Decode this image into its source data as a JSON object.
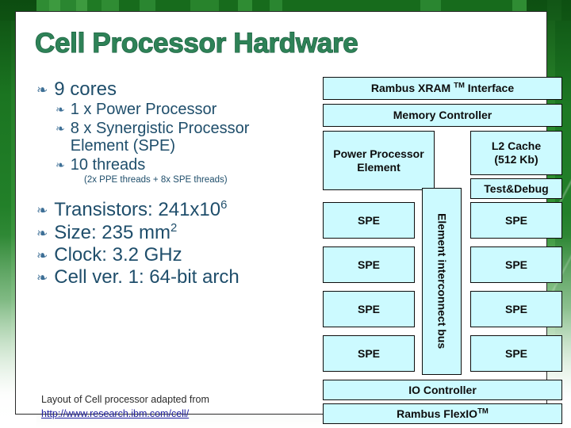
{
  "slide": {
    "title": "Cell Processor Hardware",
    "accent_green": "#2e8257",
    "text_blue": "#1f4e6b",
    "box_fill": "#ccfaff",
    "bullet_glyph": "❧"
  },
  "bullets": {
    "cores_heading": "9 cores",
    "sub": [
      {
        "text": "1 x Power Processor"
      },
      {
        "text": "8 x Synergistic Processor Element (SPE)"
      },
      {
        "text": "10 threads"
      }
    ],
    "threads_note": "(2x PPE threads + 8x SPE threads)",
    "facts": [
      {
        "label": "Transistors: 241x10",
        "sup": "6"
      },
      {
        "label": "Size: 235 mm",
        "sup": "2"
      },
      {
        "label": "Clock: 3.2 GHz",
        "sup": ""
      },
      {
        "label": "Cell ver. 1: 64-bit arch",
        "sup": ""
      }
    ]
  },
  "credit": {
    "line1": "Layout of Cell processor adapted from",
    "link": "http://www.research.ibm.com/cell/"
  },
  "diagram": {
    "xram": "Rambus XRAM",
    "xram_tm": "TM",
    "xram_tail": "Interface",
    "memory_controller": "Memory Controller",
    "ppe": "Power Processor Element",
    "l2_cache_line1": "L2 Cache",
    "l2_cache_line2": "(512 Kb)",
    "test_debug": "Test&Debug",
    "bus": "Element interconnect bus",
    "spe_label": "SPE",
    "spe_left": [
      "SPE",
      "SPE",
      "SPE",
      "SPE"
    ],
    "spe_right": [
      "SPE",
      "SPE",
      "SPE",
      "SPE"
    ],
    "io_controller": "IO Controller",
    "flexio": "Rambus FlexIO",
    "flexio_tm": "TM"
  }
}
